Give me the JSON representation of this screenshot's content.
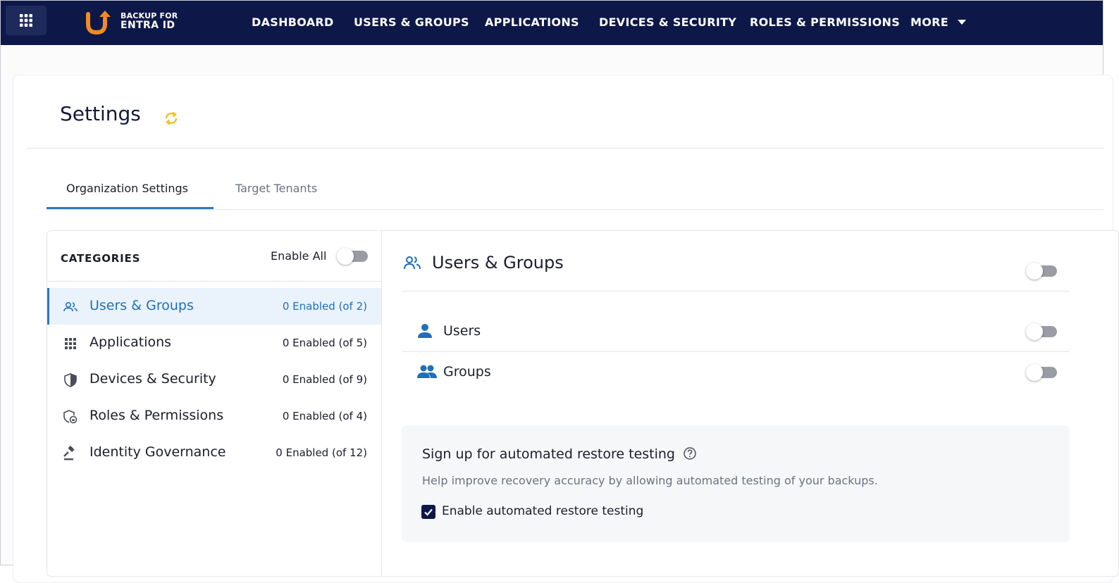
{
  "app": {
    "logo_line1": "BACKUP FOR",
    "logo_line2": "ENTRA ID",
    "brand_color": "#0e1848",
    "accent_color": "#f28c1e"
  },
  "nav": {
    "items": [
      {
        "label": "DASHBOARD"
      },
      {
        "label": "USERS & GROUPS"
      },
      {
        "label": "APPLICATIONS"
      },
      {
        "label": "DEVICES & SECURITY"
      },
      {
        "label": "ROLES & PERMISSIONS"
      },
      {
        "label": "MORE"
      }
    ]
  },
  "page": {
    "title": "Settings",
    "refresh_icon": "refresh-icon"
  },
  "tabs": [
    {
      "label": "Organization Settings",
      "active": true
    },
    {
      "label": "Target Tenants",
      "active": false
    }
  ],
  "categories": {
    "header": "CATEGORIES",
    "enable_all_label": "Enable All",
    "enable_all_on": false,
    "items": [
      {
        "label": "Users & Groups",
        "count": "0 Enabled (of 2)",
        "icon": "users-groups-icon",
        "active": true
      },
      {
        "label": "Applications",
        "count": "0 Enabled (of 5)",
        "icon": "apps-grid-icon",
        "active": false
      },
      {
        "label": "Devices & Security",
        "count": "0 Enabled (of 9)",
        "icon": "shield-icon",
        "active": false
      },
      {
        "label": "Roles & Permissions",
        "count": "0 Enabled (of 4)",
        "icon": "shield-lock-icon",
        "active": false
      },
      {
        "label": "Identity Governance",
        "count": "0 Enabled (of 12)",
        "icon": "gavel-icon",
        "active": false
      }
    ]
  },
  "detail": {
    "title": "Users & Groups",
    "section_toggle_on": false,
    "rows": [
      {
        "label": "Users",
        "icon": "user-icon",
        "enabled": false
      },
      {
        "label": "Groups",
        "icon": "group-icon",
        "enabled": false
      }
    ]
  },
  "promo": {
    "title": "Sign up for automated restore testing",
    "description": "Help improve recovery accuracy by allowing automated testing of your backups.",
    "checkbox_label": "Enable automated restore testing",
    "checked": true
  }
}
